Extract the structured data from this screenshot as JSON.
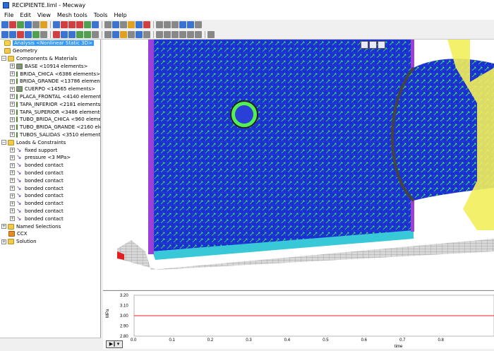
{
  "window": {
    "title": "RECIPIENTE.liml - Mecway"
  },
  "menu": [
    "File",
    "Edit",
    "View",
    "Mesh tools",
    "Tools",
    "Help"
  ],
  "toolbar_row1_colors": [
    "#3a74d0",
    "#d04040",
    "#50a050",
    "#3a74d0",
    "#888888",
    "#e0a020",
    "#3a74d0",
    "#d04040",
    "#d04040",
    "#d04040",
    "#50a050",
    "#3a74d0",
    "#888888",
    "#3a74d0",
    "#888888",
    "#e0a020",
    "#3a74d0",
    "#d04040",
    "#888888",
    "#888888",
    "#888888",
    "#3a74d0",
    "#3a74d0",
    "#888888"
  ],
  "toolbar_row2_colors": [
    "#3a74d0",
    "#3a74d0",
    "#d04040",
    "#3a74d0",
    "#50a050",
    "#888888",
    "#d04040",
    "#3a74d0",
    "#3a74d0",
    "#50a050",
    "#50a050",
    "#888888",
    "#888888",
    "#3a74d0",
    "#e0a020",
    "#888888",
    "#3a74d0",
    "#888888",
    "#888888",
    "#888888",
    "#888888",
    "#888888",
    "#888888",
    "#888888",
    "#888888"
  ],
  "tree": {
    "analysis": "Analysis <Nonlinear Static 3D>",
    "geometry": "Geometry",
    "components_header": "Components & Materials",
    "components": [
      "BASE <10914 elements>",
      "BRIDA_CHICA <6386 elements>",
      "BRIDA_GRANDE <13786 elements>",
      "CUERPO <14565 elements>",
      "PLACA_FRONTAL <4140 elements>",
      "TAPA_INFERIOR <2181 elements>",
      "TAPA_SUPERIOR <3486 elements>",
      "TUBO_BRIDA_CHICA <960 elements>",
      "TUBO_BRIDA_GRANDE <2160 elements>",
      "TUBOS_SALIDAS <3510 elements>"
    ],
    "component_colors": [
      "#8a8a8a",
      "#7a3fd0",
      "#e08030",
      "#8a8a8a",
      "#30b0c0",
      "#c060c0",
      "#7a3fd0",
      "#e05050",
      "#30a050",
      "#3050c0"
    ],
    "loads_header": "Loads & Constraints",
    "loads": [
      "fixed support",
      "pressure <3 MPa>",
      "bonded contact",
      "bonded contact",
      "bonded contact",
      "bonded contact",
      "bonded contact",
      "bonded contact",
      "bonded contact",
      "bonded contact"
    ],
    "named_selections": "Named Selections",
    "ccx": "CCX",
    "solution": "Solution"
  },
  "plot": {
    "ylabel": "MPa",
    "xlabel": "time",
    "yticks": [
      "3.20",
      "3.10",
      "3.00",
      "2.90",
      "2.80"
    ],
    "xticks": [
      "0.0",
      "0.1",
      "0.2",
      "0.3",
      "0.4",
      "0.5",
      "0.6",
      "0.7",
      "0.8"
    ],
    "line_value": "3.00",
    "line_color": "#e02020"
  },
  "player": {
    "label": "▶‖ ▾"
  }
}
